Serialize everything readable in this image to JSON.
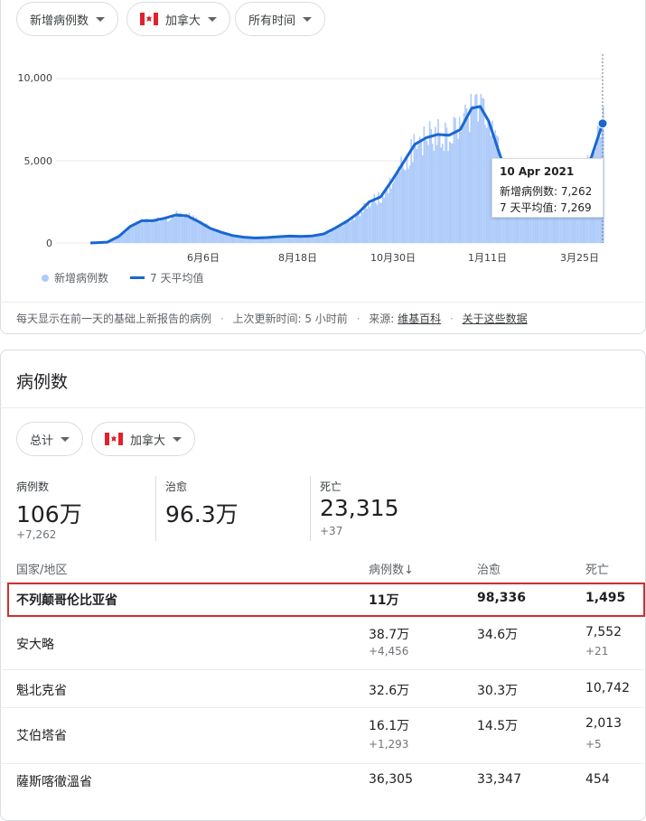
{
  "filters": {
    "metric": "新增病例数",
    "region": "加拿大",
    "time": "所有时间"
  },
  "chart_data": {
    "type": "bar",
    "y_ticks": [
      "10,000",
      "5,000",
      "0"
    ],
    "ylim": [
      0,
      10000
    ],
    "x_ticks": [
      "6月6日",
      "8月18日",
      "10月30日",
      "1月11日",
      "3月25日"
    ],
    "legend": [
      "新增病例数",
      "7 天平均值"
    ],
    "series": [
      {
        "name": "7 天平均值",
        "points": [
          [
            0,
            0
          ],
          [
            6,
            50
          ],
          [
            10,
            400
          ],
          [
            14,
            1000
          ],
          [
            18,
            1350
          ],
          [
            22,
            1350
          ],
          [
            26,
            1500
          ],
          [
            30,
            1700
          ],
          [
            34,
            1650
          ],
          [
            38,
            1300
          ],
          [
            42,
            900
          ],
          [
            46,
            650
          ],
          [
            50,
            450
          ],
          [
            54,
            350
          ],
          [
            58,
            300
          ],
          [
            62,
            330
          ],
          [
            66,
            380
          ],
          [
            70,
            420
          ],
          [
            74,
            400
          ],
          [
            78,
            430
          ],
          [
            82,
            550
          ],
          [
            86,
            900
          ],
          [
            90,
            1300
          ],
          [
            94,
            1800
          ],
          [
            98,
            2500
          ],
          [
            102,
            2800
          ],
          [
            106,
            3800
          ],
          [
            110,
            4900
          ],
          [
            114,
            6000
          ],
          [
            118,
            6400
          ],
          [
            122,
            6600
          ],
          [
            126,
            6550
          ],
          [
            130,
            6900
          ],
          [
            134,
            8200
          ],
          [
            137,
            8300
          ],
          [
            140,
            7400
          ],
          [
            144,
            5300
          ],
          [
            148,
            3500
          ],
          [
            152,
            2800
          ],
          [
            156,
            3000
          ],
          [
            160,
            3100
          ],
          [
            164,
            3000
          ],
          [
            168,
            3400
          ],
          [
            172,
            4200
          ],
          [
            176,
            5200
          ],
          [
            180,
            7269
          ]
        ]
      }
    ],
    "tooltip": {
      "date": "10 Apr 2021",
      "new_cases": "新增病例数: 7,262",
      "avg7": "7 天平均值: 7,269"
    }
  },
  "footer": {
    "note": "每天显示在前一天的基础上新报告的病例",
    "updated": "上次更新时间: 5 小时前",
    "source_label": "来源:",
    "source_link": "维基百科",
    "about_link": "关于这些数据"
  },
  "cases_section": {
    "title": "病例数",
    "filter_total": "总计",
    "filter_region": "加拿大",
    "stats": {
      "cases_label": "病例数",
      "cases_value": "106万",
      "cases_delta": "+7,262",
      "recovered_label": "治愈",
      "recovered_value": "96.3万",
      "deaths_label": "死亡",
      "deaths_value": "23,315",
      "deaths_delta": "+37"
    },
    "table": {
      "headers": [
        "国家/地区",
        "病例数↓",
        "治愈",
        "死亡"
      ],
      "rows": [
        {
          "name": "不列颠哥伦比亚省",
          "cases": "11万",
          "cases_delta": "",
          "recovered": "98,336",
          "deaths": "1,495",
          "deaths_delta": ""
        },
        {
          "name": "安大略",
          "cases": "38.7万",
          "cases_delta": "+4,456",
          "recovered": "34.6万",
          "deaths": "7,552",
          "deaths_delta": "+21"
        },
        {
          "name": "魁北克省",
          "cases": "32.6万",
          "cases_delta": "",
          "recovered": "30.3万",
          "deaths": "10,742",
          "deaths_delta": ""
        },
        {
          "name": "艾伯塔省",
          "cases": "16.1万",
          "cases_delta": "+1,293",
          "recovered": "14.5万",
          "deaths": "2,013",
          "deaths_delta": "+5"
        },
        {
          "name": "薩斯喀徹溫省",
          "cases": "36,305",
          "cases_delta": "",
          "recovered": "33,347",
          "deaths": "454",
          "deaths_delta": ""
        }
      ]
    }
  }
}
